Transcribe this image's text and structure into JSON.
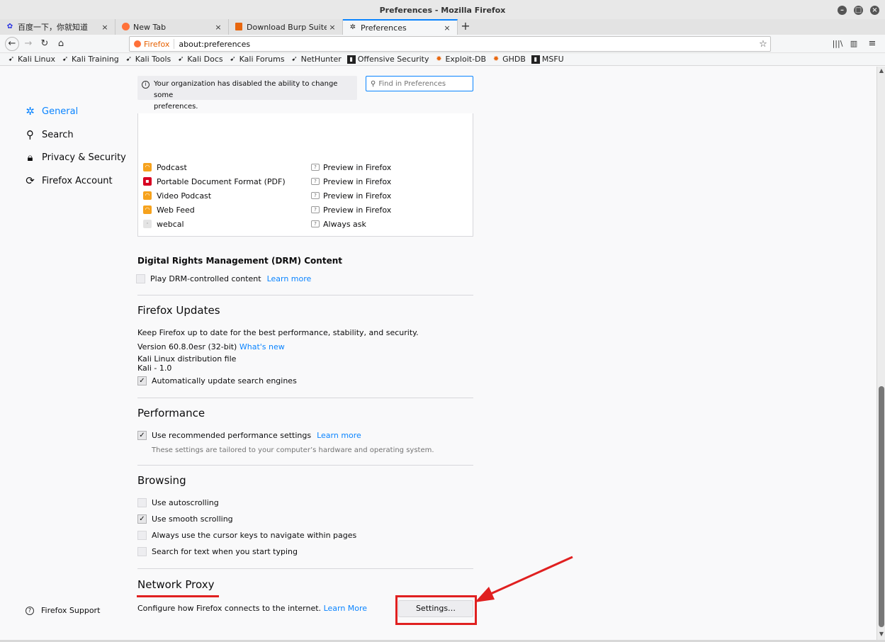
{
  "window": {
    "title": "Preferences - Mozilla Firefox"
  },
  "tabs": [
    {
      "label": "百度一下，你就知道",
      "icon": "baidu-icon"
    },
    {
      "label": "New Tab",
      "icon": "firefox-icon"
    },
    {
      "label": "Download Burp Suite Co",
      "icon": "burp-icon"
    },
    {
      "label": "Preferences",
      "icon": "gear-icon"
    }
  ],
  "tab_close_glyph": "×",
  "newtab_glyph": "+",
  "navbar": {
    "identity_label": "Firefox",
    "url": "about:preferences"
  },
  "bookmarks": [
    {
      "label": "Kali Linux"
    },
    {
      "label": "Kali Training"
    },
    {
      "label": "Kali Tools"
    },
    {
      "label": "Kali Docs"
    },
    {
      "label": "Kali Forums"
    },
    {
      "label": "NetHunter"
    },
    {
      "label": "Offensive Security"
    },
    {
      "label": "Exploit-DB"
    },
    {
      "label": "GHDB"
    },
    {
      "label": "MSFU"
    }
  ],
  "sidebar": {
    "items": [
      {
        "label": "General",
        "icon": "gear-icon",
        "selected": true
      },
      {
        "label": "Search",
        "icon": "search-icon"
      },
      {
        "label": "Privacy & Security",
        "icon": "lock-icon"
      },
      {
        "label": "Firefox Account",
        "icon": "sync-icon"
      }
    ],
    "support_label": "Firefox Support"
  },
  "policy_notice": {
    "line1": "Your organization has disabled the ability to change some",
    "line2": "preferences."
  },
  "search": {
    "placeholder": "Find in Preferences"
  },
  "applications": [
    {
      "type": "Podcast",
      "type_icon": "rss",
      "action": "Preview in Firefox"
    },
    {
      "type": "Portable Document Format (PDF)",
      "type_icon": "pdf",
      "action": "Preview in Firefox"
    },
    {
      "type": "Video Podcast",
      "type_icon": "rss",
      "action": "Preview in Firefox"
    },
    {
      "type": "Web Feed",
      "type_icon": "rss",
      "action": "Preview in Firefox"
    },
    {
      "type": "webcal",
      "type_icon": "generic",
      "action": "Always ask"
    }
  ],
  "drm": {
    "heading": "Digital Rights Management (DRM) Content",
    "checkbox_label": "Play DRM-controlled content",
    "checked": false,
    "learn_more": "Learn more"
  },
  "updates": {
    "heading": "Firefox Updates",
    "description": "Keep Firefox up to date for the best performance, stability, and security.",
    "version": "Version 60.8.0esr (32-bit)",
    "whats_new": "What's new",
    "distribution": "Kali Linux distribution file",
    "distribution_version": "Kali - 1.0",
    "auto_update_label": "Automatically update search engines",
    "auto_update_checked": true
  },
  "performance": {
    "heading": "Performance",
    "recommended_label": "Use recommended performance settings",
    "recommended_checked": true,
    "learn_more": "Learn more",
    "note": "These settings are tailored to your computer’s hardware and operating system."
  },
  "browsing": {
    "heading": "Browsing",
    "options": [
      {
        "label": "Use autoscrolling",
        "checked": false
      },
      {
        "label": "Use smooth scrolling",
        "checked": true
      },
      {
        "label": "Always use the cursor keys to navigate within pages",
        "checked": false
      },
      {
        "label": "Search for text when you start typing",
        "checked": false
      }
    ]
  },
  "network_proxy": {
    "heading": "Network Proxy",
    "description": "Configure how Firefox connects to the internet.",
    "learn_more": "Learn More",
    "settings_button": "Settings…"
  },
  "check_glyph": "✓",
  "colors": {
    "accent": "#0a84ff",
    "annotation": "#e02020"
  }
}
